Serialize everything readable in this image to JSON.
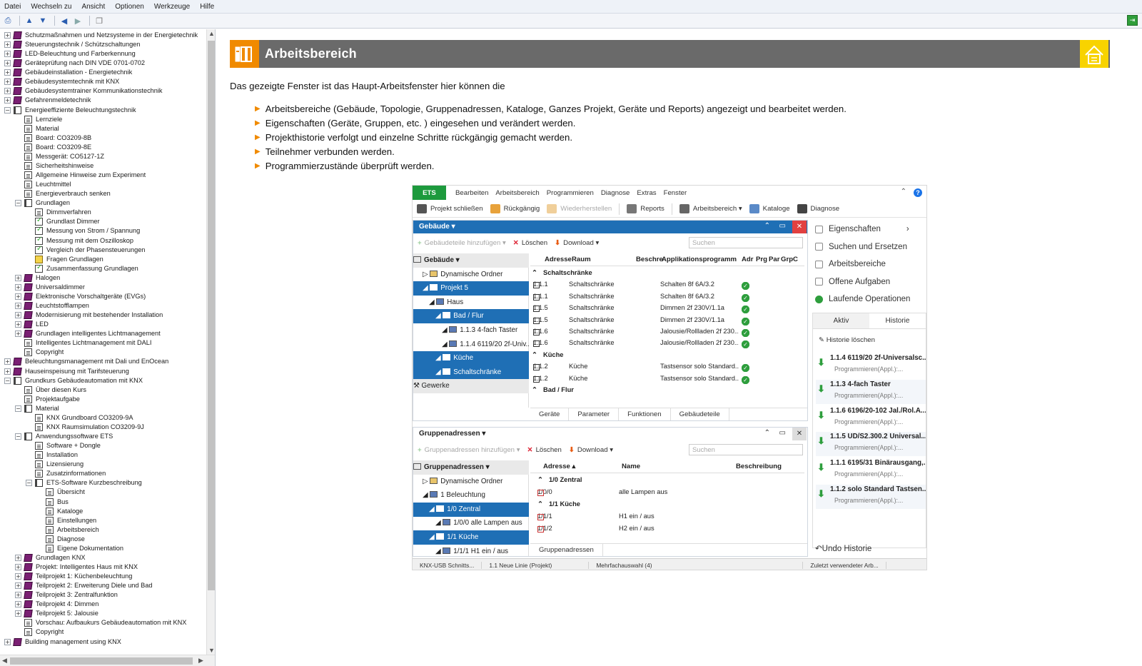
{
  "menubar": [
    "Datei",
    "Wechseln zu",
    "Ansicht",
    "Optionen",
    "Werkzeuge",
    "Hilfe"
  ],
  "toolbar": {
    "icons": [
      "print-icon",
      "arrow-up-icon",
      "arrow-down-icon",
      "back-icon",
      "forward-icon",
      "copy-icon"
    ],
    "right_icon": "exit-icon"
  },
  "tree": [
    {
      "t": "Schutzmaßnahmen und Netzsysteme in der Energietechnik",
      "l": 0,
      "i": "book",
      "x": "+"
    },
    {
      "t": "Steuerungstechnik / Schützschaltungen",
      "l": 0,
      "i": "book",
      "x": "+"
    },
    {
      "t": "LED-Beleuchtung und Farberkennung",
      "l": 0,
      "i": "book",
      "x": "+"
    },
    {
      "t": "Geräteprüfung nach DIN VDE 0701-0702",
      "l": 0,
      "i": "book",
      "x": "+"
    },
    {
      "t": "Gebäudeinstallation - Energietechnik",
      "l": 0,
      "i": "book",
      "x": "+"
    },
    {
      "t": "Gebäudesystemtechnik mit KNX",
      "l": 0,
      "i": "book",
      "x": "+"
    },
    {
      "t": "Gebäudesystemtrainer Kommunikationstechnik",
      "l": 0,
      "i": "book",
      "x": "+"
    },
    {
      "t": "Gefahrenmeldetechnik",
      "l": 0,
      "i": "book",
      "x": "+"
    },
    {
      "t": "Energieeffiziente Beleuchtungstechnik",
      "l": 0,
      "i": "open",
      "x": "-"
    },
    {
      "t": "Lernziele",
      "l": 1,
      "i": "page",
      "x": ""
    },
    {
      "t": "Material",
      "l": 1,
      "i": "page",
      "x": ""
    },
    {
      "t": "Board: CO3209-8B",
      "l": 1,
      "i": "page",
      "x": ""
    },
    {
      "t": "Board: CO3209-8E",
      "l": 1,
      "i": "page",
      "x": ""
    },
    {
      "t": "Messgerät: CO5127-1Z",
      "l": 1,
      "i": "page",
      "x": ""
    },
    {
      "t": "Sicherheitshinweise",
      "l": 1,
      "i": "page",
      "x": ""
    },
    {
      "t": "Allgemeine Hinweise zum Experiment",
      "l": 1,
      "i": "page",
      "x": ""
    },
    {
      "t": "Leuchtmittel",
      "l": 1,
      "i": "page",
      "x": ""
    },
    {
      "t": "Energieverbrauch senken",
      "l": 1,
      "i": "page",
      "x": ""
    },
    {
      "t": "Grundlagen",
      "l": 1,
      "i": "open",
      "x": "-"
    },
    {
      "t": "Dimmverfahren",
      "l": 2,
      "i": "page",
      "x": ""
    },
    {
      "t": "Grundlast Dimmer",
      "l": 2,
      "i": "check",
      "x": ""
    },
    {
      "t": "Messung von Strom / Spannung",
      "l": 2,
      "i": "check",
      "x": ""
    },
    {
      "t": "Messung mit dem Oszilloskop",
      "l": 2,
      "i": "check",
      "x": ""
    },
    {
      "t": "Vergleich der Phasensteuerungen",
      "l": 2,
      "i": "check",
      "x": ""
    },
    {
      "t": "Fragen Grundlagen",
      "l": 2,
      "i": "quiz",
      "x": ""
    },
    {
      "t": "Zusammenfassung Grundlagen",
      "l": 2,
      "i": "check",
      "x": ""
    },
    {
      "t": "Halogen",
      "l": 1,
      "i": "book",
      "x": "+"
    },
    {
      "t": "Universaldimmer",
      "l": 1,
      "i": "book",
      "x": "+"
    },
    {
      "t": "Elektronische Vorschaltgeräte (EVGs)",
      "l": 1,
      "i": "book",
      "x": "+"
    },
    {
      "t": "Leuchtstofflampen",
      "l": 1,
      "i": "book",
      "x": "+"
    },
    {
      "t": "Modernisierung mit bestehender Installation",
      "l": 1,
      "i": "book",
      "x": "+"
    },
    {
      "t": "LED",
      "l": 1,
      "i": "book",
      "x": "+"
    },
    {
      "t": "Grundlagen intelligentes Lichtmanagement",
      "l": 1,
      "i": "book",
      "x": "+"
    },
    {
      "t": "Intelligentes Lichtmanagement mit DALI",
      "l": 1,
      "i": "page",
      "x": ""
    },
    {
      "t": "Copyright",
      "l": 1,
      "i": "page",
      "x": ""
    },
    {
      "t": "Beleuchtungsmanagement mit Dali und EnOcean",
      "l": 0,
      "i": "book",
      "x": "+"
    },
    {
      "t": "Hauseinspeisung mit Tarifsteuerung",
      "l": 0,
      "i": "book",
      "x": "+"
    },
    {
      "t": "Grundkurs Gebäudeautomation mit KNX",
      "l": 0,
      "i": "open",
      "x": "-"
    },
    {
      "t": "Über diesen Kurs",
      "l": 1,
      "i": "page",
      "x": ""
    },
    {
      "t": "Projektaufgabe",
      "l": 1,
      "i": "page",
      "x": ""
    },
    {
      "t": "Material",
      "l": 1,
      "i": "open",
      "x": "-"
    },
    {
      "t": "KNX Grundboard CO3209-9A",
      "l": 2,
      "i": "page",
      "x": ""
    },
    {
      "t": "KNX Raumsimulation CO3209-9J",
      "l": 2,
      "i": "page",
      "x": ""
    },
    {
      "t": "Anwendungssoftware ETS",
      "l": 1,
      "i": "open",
      "x": "-"
    },
    {
      "t": "Software + Dongle",
      "l": 2,
      "i": "page",
      "x": ""
    },
    {
      "t": "Installation",
      "l": 2,
      "i": "page",
      "x": ""
    },
    {
      "t": "Lizensierung",
      "l": 2,
      "i": "page",
      "x": ""
    },
    {
      "t": "Zusatzinformationen",
      "l": 2,
      "i": "page",
      "x": ""
    },
    {
      "t": "ETS-Software Kurzbeschreibung",
      "l": 2,
      "i": "open",
      "x": "-"
    },
    {
      "t": "Übersicht",
      "l": 3,
      "i": "page",
      "x": ""
    },
    {
      "t": "Bus",
      "l": 3,
      "i": "page",
      "x": ""
    },
    {
      "t": "Kataloge",
      "l": 3,
      "i": "page",
      "x": ""
    },
    {
      "t": "Einstellungen",
      "l": 3,
      "i": "page",
      "x": ""
    },
    {
      "t": "Arbeitsbereich",
      "l": 3,
      "i": "page",
      "x": ""
    },
    {
      "t": "Diagnose",
      "l": 3,
      "i": "page",
      "x": ""
    },
    {
      "t": "Eigene Dokumentation",
      "l": 3,
      "i": "page",
      "x": ""
    },
    {
      "t": "Grundlagen KNX",
      "l": 1,
      "i": "book",
      "x": "+"
    },
    {
      "t": "Projekt: Intelligentes Haus mit KNX",
      "l": 1,
      "i": "book",
      "x": "+"
    },
    {
      "t": "Teilprojekt 1: Küchenbeleuchtung",
      "l": 1,
      "i": "book",
      "x": "+"
    },
    {
      "t": "Teilprojekt 2: Erweiterung Diele und Bad",
      "l": 1,
      "i": "book",
      "x": "+"
    },
    {
      "t": "Teilprojekt 3: Zentralfunktion",
      "l": 1,
      "i": "book",
      "x": "+"
    },
    {
      "t": "Teilprojekt 4: Dimmen",
      "l": 1,
      "i": "book",
      "x": "+"
    },
    {
      "t": "Teilprojekt 5: Jalousie",
      "l": 1,
      "i": "book",
      "x": "+"
    },
    {
      "t": "Vorschau: Aufbaukurs Gebäudeautomation mit KNX",
      "l": 1,
      "i": "page",
      "x": ""
    },
    {
      "t": "Copyright",
      "l": 1,
      "i": "page",
      "x": ""
    },
    {
      "t": "Building management using KNX",
      "l": 0,
      "i": "book",
      "x": "+"
    }
  ],
  "content": {
    "title": "Arbeitsbereich",
    "intro": "Das gezeigte Fenster ist das Haupt-Arbeitsfenster hier können die",
    "bullets": [
      "Arbeitsbereiche (Gebäude, Topologie, Gruppenadressen, Kataloge, Ganzes Projekt, Geräte und Reports) angezeigt und bearbeitet werden.",
      "Eigenschaften (Geräte, Gruppen, etc. ) eingesehen und verändert werden.",
      "Projekthistorie verfolgt und einzelne Schritte rückgängig gemacht werden.",
      "Teilnehmer verbunden werden.",
      "Programmierzustände überprüft werden."
    ]
  },
  "ets": {
    "logo": "ETS",
    "menu": [
      "Bearbeiten",
      "Arbeitsbereich",
      "Programmieren",
      "Diagnose",
      "Extras",
      "Fenster"
    ],
    "tools": [
      {
        "t": "Projekt schließen",
        "d": false,
        "c": "#555"
      },
      {
        "t": "Rückgängig",
        "d": false,
        "c": "#e8a23a"
      },
      {
        "t": "Wiederherstellen",
        "d": true,
        "c": "#f0cf9a"
      },
      {
        "t": "Reports",
        "d": false,
        "c": "#777"
      },
      {
        "t": "Arbeitsbereich ▾",
        "d": false,
        "c": "#666"
      },
      {
        "t": "Kataloge",
        "d": false,
        "c": "#5a8ac8"
      },
      {
        "t": "Diagnose",
        "d": false,
        "c": "#444"
      }
    ],
    "geb": {
      "title": "Gebäude ▾",
      "add": "Gebäudeteile hinzufügen",
      "del": "Löschen",
      "dl": "Download",
      "search": "Suchen",
      "tree_hdr": "Gebäude",
      "tree": [
        {
          "t": "Dynamische Ordner",
          "d": 1,
          "s": false
        },
        {
          "t": "Projekt 5",
          "d": 1,
          "s": true
        },
        {
          "t": "Haus",
          "d": 2,
          "s": false
        },
        {
          "t": "Bad / Flur",
          "d": 3,
          "s": true
        },
        {
          "t": "1.1.3 4-fach Taster",
          "d": 4,
          "s": false
        },
        {
          "t": "1.1.4 6119/20 2f-Univ...",
          "d": 4,
          "s": false
        },
        {
          "t": "Küche",
          "d": 3,
          "s": true
        },
        {
          "t": "Schaltschränke",
          "d": 3,
          "s": true
        }
      ],
      "gewerke": "Gewerke",
      "cols": [
        "Adresse",
        "Raum",
        "Beschre",
        "Applikationsprogramm",
        "Adr",
        "Prg",
        "Par",
        "Grp",
        "C"
      ],
      "rows": [
        {
          "g": "Schaltschränke"
        },
        {
          "a": "1.1.1",
          "r": "Schaltschränke",
          "p": "Schalten 8f 6A/3.2"
        },
        {
          "a": "1.1.1",
          "r": "Schaltschränke",
          "p": "Schalten 8f 6A/3.2"
        },
        {
          "a": "1.1.5",
          "r": "Schaltschränke",
          "p": "Dimmen 2f 230V/1.1a"
        },
        {
          "a": "1.1.5",
          "r": "Schaltschränke",
          "p": "Dimmen 2f 230V/1.1a"
        },
        {
          "a": "1.1.6",
          "r": "Schaltschränke",
          "p": "Jalousie/Rollladen 2f 230..."
        },
        {
          "a": "1.1.6",
          "r": "Schaltschränke",
          "p": "Jalousie/Rollladen 2f 230..."
        },
        {
          "g": "Küche"
        },
        {
          "a": "1.1.2",
          "r": "Küche",
          "p": "Tastsensor solo Standard..."
        },
        {
          "a": "1.1.2",
          "r": "Küche",
          "p": "Tastsensor solo Standard..."
        },
        {
          "g": "Bad / Flur"
        }
      ],
      "tabs": [
        "Geräte",
        "Parameter",
        "Funktionen",
        "Gebäudeteile"
      ]
    },
    "grp": {
      "title": "Gruppenadressen ▾",
      "add": "Gruppenadressen hinzufügen",
      "del": "Löschen",
      "dl": "Download",
      "search": "Suchen",
      "tree_hdr": "Gruppenadressen",
      "tree": [
        {
          "t": "Dynamische Ordner",
          "d": 1,
          "s": false
        },
        {
          "t": "1 Beleuchtung",
          "d": 1,
          "s": false
        },
        {
          "t": "1/0 Zentral",
          "d": 2,
          "s": true
        },
        {
          "t": "1/0/0 alle Lampen aus",
          "d": 3,
          "s": false
        },
        {
          "t": "1/1 Küche",
          "d": 2,
          "s": true
        },
        {
          "t": "1/1/1 H1 ein / aus",
          "d": 3,
          "s": false
        }
      ],
      "cols": [
        "Adresse ▴",
        "Name",
        "Beschreibung"
      ],
      "rows": [
        {
          "g": "1/0 Zentral"
        },
        {
          "a": "1/0/0",
          "n": "alle Lampen aus"
        },
        {
          "g": "1/1 Küche"
        },
        {
          "a": "1/1/1",
          "n": "H1 ein / aus"
        },
        {
          "a": "1/1/2",
          "n": "H2 ein / aus"
        }
      ],
      "tab": "Gruppenadressen"
    },
    "right": {
      "items": [
        "Eigenschaften",
        "Suchen und Ersetzen",
        "Arbeitsbereiche",
        "Offene Aufgaben",
        "Laufende Operationen"
      ],
      "tabs": [
        "Aktiv",
        "Historie"
      ],
      "clear": "Historie löschen",
      "entries": [
        {
          "t": "1.1.4 6119/20 2f-Universalsc...",
          "s": "Programmieren(Appl.):..."
        },
        {
          "t": "1.1.3 4-fach Taster",
          "s": "Programmieren(Appl.):..."
        },
        {
          "t": "1.1.6 6196/20-102 Jal./Rol.A...",
          "s": "Programmieren(Appl.):..."
        },
        {
          "t": "1.1.5 UD/S2.300.2 Universal...",
          "s": "Programmieren(Appl.):..."
        },
        {
          "t": "1.1.1 6195/31 Binärausgang,...",
          "s": "Programmieren(Appl.):..."
        },
        {
          "t": "1.1.2 solo Standard Tastsen...",
          "s": "Programmieren(Appl.):..."
        }
      ],
      "undo": "Undo Historie"
    },
    "status": [
      "KNX-USB Schnitts...",
      "1.1 Neue Linie (Projekt)",
      "Mehrfachauswahl (4)",
      "Zuletzt verwendeter Arb..."
    ]
  }
}
